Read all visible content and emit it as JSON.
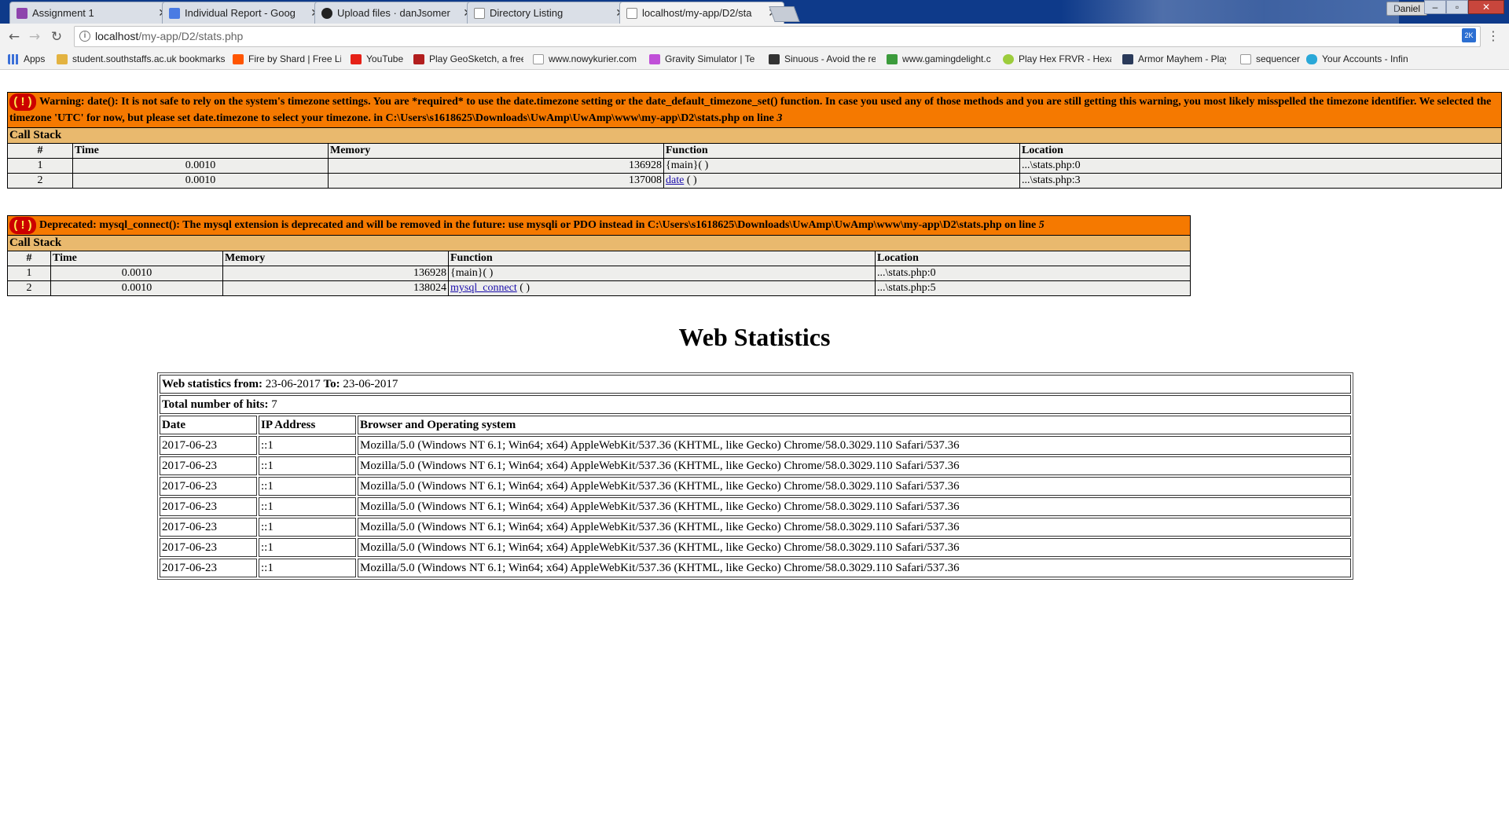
{
  "browser": {
    "tabs": [
      {
        "title": "Assignment 1",
        "icon": "assignment-icon",
        "color": "#8e44ad"
      },
      {
        "title": "Individual Report - Goog",
        "icon": "docs-icon",
        "color": "#4a7be3"
      },
      {
        "title": "Upload files · danJsomer",
        "icon": "github-icon",
        "color": "#222222"
      },
      {
        "title": "Directory Listing",
        "icon": "page-icon",
        "color": "#888888"
      },
      {
        "title": "localhost/my-app/D2/sta",
        "icon": "page-icon",
        "color": "#888888"
      }
    ],
    "user_label": "Daniel",
    "window_buttons": {
      "minimize": "–",
      "maximize": "▫",
      "close": "✕"
    },
    "url_host": "localhost",
    "url_path": "/my-app/D2/stats.php",
    "extension_label": "2K",
    "bookmarks": [
      {
        "label": "Apps",
        "icon": "apps-grid-icon",
        "color": "#3a6fd8"
      },
      {
        "label": "student.southstaffs.ac.uk bookmarks",
        "icon": "folder-icon",
        "color": "#e3b341"
      },
      {
        "label": "Fire by Shard | Free Li",
        "icon": "soundcloud-icon",
        "color": "#ff5500"
      },
      {
        "label": "YouTube",
        "icon": "youtube-icon",
        "color": "#e62117"
      },
      {
        "label": "Play GeoSketch, a free",
        "icon": "k-icon",
        "color": "#b21e1e"
      },
      {
        "label": "www.nowykurier.com",
        "icon": "page-icon",
        "color": "#aaaaaa"
      },
      {
        "label": "Gravity Simulator | Te",
        "icon": "feather-icon",
        "color": "#c04fd8"
      },
      {
        "label": "Sinuous - Avoid the re",
        "icon": "s-icon",
        "color": "#333333"
      },
      {
        "label": "www.gamingdelight.c",
        "icon": "gd-icon",
        "color": "#3c9b3c"
      },
      {
        "label": "Play Hex FRVR - Hexa",
        "icon": "hex-icon",
        "color": "#9ccc3c"
      },
      {
        "label": "Armor Mayhem - Play",
        "icon": "shield-icon",
        "color": "#2a3a5a"
      },
      {
        "label": "sequencer",
        "icon": "page-icon",
        "color": "#aaaaaa"
      },
      {
        "label": "Your Accounts - Infin",
        "icon": "infinity-icon",
        "color": "#2aa8d8"
      }
    ]
  },
  "warning": {
    "badge": "( ! )",
    "message": "Warning: date(): It is not safe to rely on the system's timezone settings. You are *required* to use the date.timezone setting or the date_default_timezone_set() function. In case you used any of those methods and you are still getting this warning, you most likely misspelled the timezone identifier. We selected the timezone 'UTC' for now, but please set date.timezone to select your timezone. in C:\\Users\\s1618625\\Downloads\\UwAmp\\UwAmp\\www\\my-app\\D2\\stats.php on line ",
    "line": "3",
    "call_stack_label": "Call Stack",
    "columns": [
      "#",
      "Time",
      "Memory",
      "Function",
      "Location"
    ],
    "rows": [
      {
        "num": "1",
        "time": "0.0010",
        "memory": "136928",
        "func": "{main}",
        "args": "( )",
        "location": "...\\stats.php:0"
      },
      {
        "num": "2",
        "time": "0.0010",
        "memory": "137008",
        "func": "date",
        "args": " ( )",
        "location": "...\\stats.php:3"
      }
    ]
  },
  "deprecated": {
    "badge": "( ! )",
    "message": "Deprecated: mysql_connect(): The mysql extension is deprecated and will be removed in the future: use mysqli or PDO instead in C:\\Users\\s1618625\\Downloads\\UwAmp\\UwAmp\\www\\my-app\\D2\\stats.php on line ",
    "line": "5",
    "call_stack_label": "Call Stack",
    "columns": [
      "#",
      "Time",
      "Memory",
      "Function",
      "Location"
    ],
    "rows": [
      {
        "num": "1",
        "time": "0.0010",
        "memory": "136928",
        "func": "{main}",
        "args": "( )",
        "location": "...\\stats.php:0"
      },
      {
        "num": "2",
        "time": "0.0010",
        "memory": "138024",
        "func": "mysql_connect",
        "args": " ( )",
        "location": "...\\stats.php:5"
      }
    ]
  },
  "stats": {
    "title": "Web Statistics",
    "from_label": "Web statistics from:",
    "from_date": " 23-06-2017 ",
    "to_label": "To:",
    "to_date": " 23-06-2017",
    "hits_label": "Total number of hits:",
    "hits_value": " 7",
    "columns": [
      "Date",
      "IP Address",
      "Browser and Operating system"
    ],
    "rows": [
      {
        "date": "2017-06-23",
        "ip": "::1",
        "agent": "Mozilla/5.0 (Windows NT 6.1; Win64; x64) AppleWebKit/537.36 (KHTML, like Gecko) Chrome/58.0.3029.110 Safari/537.36"
      },
      {
        "date": "2017-06-23",
        "ip": "::1",
        "agent": "Mozilla/5.0 (Windows NT 6.1; Win64; x64) AppleWebKit/537.36 (KHTML, like Gecko) Chrome/58.0.3029.110 Safari/537.36"
      },
      {
        "date": "2017-06-23",
        "ip": "::1",
        "agent": "Mozilla/5.0 (Windows NT 6.1; Win64; x64) AppleWebKit/537.36 (KHTML, like Gecko) Chrome/58.0.3029.110 Safari/537.36"
      },
      {
        "date": "2017-06-23",
        "ip": "::1",
        "agent": "Mozilla/5.0 (Windows NT 6.1; Win64; x64) AppleWebKit/537.36 (KHTML, like Gecko) Chrome/58.0.3029.110 Safari/537.36"
      },
      {
        "date": "2017-06-23",
        "ip": "::1",
        "agent": "Mozilla/5.0 (Windows NT 6.1; Win64; x64) AppleWebKit/537.36 (KHTML, like Gecko) Chrome/58.0.3029.110 Safari/537.36"
      },
      {
        "date": "2017-06-23",
        "ip": "::1",
        "agent": "Mozilla/5.0 (Windows NT 6.1; Win64; x64) AppleWebKit/537.36 (KHTML, like Gecko) Chrome/58.0.3029.110 Safari/537.36"
      },
      {
        "date": "2017-06-23",
        "ip": "::1",
        "agent": "Mozilla/5.0 (Windows NT 6.1; Win64; x64) AppleWebKit/537.36 (KHTML, like Gecko) Chrome/58.0.3029.110 Safari/537.36"
      }
    ]
  }
}
